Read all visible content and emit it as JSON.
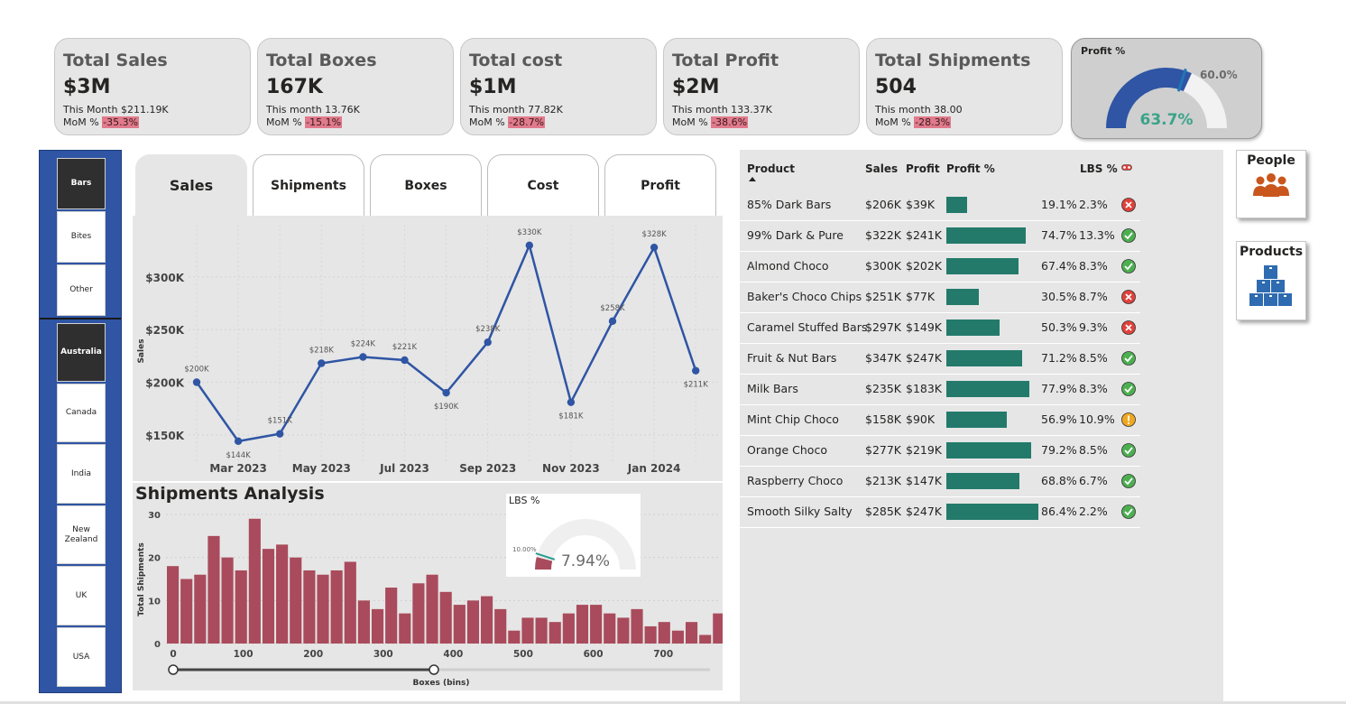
{
  "kpis": [
    {
      "title": "Total Sales",
      "value": "$3M",
      "month": "This Month $211.19K",
      "mom_label": "MoM % ",
      "mom": "-35.3%"
    },
    {
      "title": "Total Boxes",
      "value": "167K",
      "month": "This month 13.76K",
      "mom_label": "MoM % ",
      "mom": "-15.1%"
    },
    {
      "title": "Total cost",
      "value": "$1M",
      "month": "This month 77.82K",
      "mom_label": "MoM % ",
      "mom": "-28.7%"
    },
    {
      "title": "Total Profit",
      "value": "$2M",
      "month": "This month 133.37K",
      "mom_label": "MoM % ",
      "mom": "-38.6%"
    },
    {
      "title": "Total Shipments",
      "value": "504",
      "month": "This month 38.00",
      "mom_label": "MoM % ",
      "mom": "-28.3%"
    }
  ],
  "profit_gauge": {
    "title": "Profit %",
    "value": "63.7%",
    "target": "60.0%",
    "fill_fraction": 0.637,
    "target_fraction": 0.6
  },
  "slicer": {
    "categories": [
      "Bars",
      "Bites",
      "Other"
    ],
    "selected_category": "Bars",
    "countries": [
      "Australia",
      "Canada",
      "India",
      "New Zealand",
      "UK",
      "USA"
    ],
    "selected_country": "Australia"
  },
  "tabs": [
    "Sales",
    "Shipments",
    "Boxes",
    "Cost",
    "Profit"
  ],
  "active_tab": "Sales",
  "line_chart": {
    "ylabel": "Sales",
    "yticks": [
      "$300K",
      "$250K",
      "$200K",
      "$150K"
    ],
    "xticks": [
      "Mar 2023",
      "May 2023",
      "Jul 2023",
      "Sep 2023",
      "Nov 2023",
      "Jan 2024"
    ]
  },
  "shipments": {
    "title": "Shipments Analysis",
    "ylabel": "Total Shipments",
    "xlabel": "Boxes (bins)",
    "yticks": [
      "30",
      "20",
      "10",
      "0"
    ],
    "xticks": [
      "0",
      "100",
      "200",
      "300",
      "400",
      "500",
      "600",
      "700"
    ]
  },
  "lbs_gauge": {
    "title": "LBS %",
    "value": "7.94%",
    "target": "10.00%",
    "fill_fraction": 0.0794,
    "target_fraction": 0.1
  },
  "table": {
    "headers": {
      "product": "Product",
      "sales": "Sales",
      "profit": "Profit",
      "profit_pct": "Profit %",
      "lbs": "LBS %"
    },
    "rows": [
      {
        "product": "85% Dark Bars",
        "sales": "$206K",
        "profit": "$39K",
        "pct": "19.1%",
        "pct_value": 19.1,
        "lbs": "2.3%",
        "status": "bad"
      },
      {
        "product": "99% Dark & Pure",
        "sales": "$322K",
        "profit": "$241K",
        "pct": "74.7%",
        "pct_value": 74.7,
        "lbs": "13.3%",
        "status": "good"
      },
      {
        "product": "Almond Choco",
        "sales": "$300K",
        "profit": "$202K",
        "pct": "67.4%",
        "pct_value": 67.4,
        "lbs": "8.3%",
        "status": "good"
      },
      {
        "product": "Baker's Choco Chips",
        "sales": "$251K",
        "profit": "$77K",
        "pct": "30.5%",
        "pct_value": 30.5,
        "lbs": "8.7%",
        "status": "bad"
      },
      {
        "product": "Caramel Stuffed Bars",
        "sales": "$297K",
        "profit": "$149K",
        "pct": "50.3%",
        "pct_value": 50.3,
        "lbs": "9.3%",
        "status": "bad"
      },
      {
        "product": "Fruit & Nut Bars",
        "sales": "$347K",
        "profit": "$247K",
        "pct": "71.2%",
        "pct_value": 71.2,
        "lbs": "8.5%",
        "status": "good"
      },
      {
        "product": "Milk Bars",
        "sales": "$235K",
        "profit": "$183K",
        "pct": "77.9%",
        "pct_value": 77.9,
        "lbs": "8.3%",
        "status": "good"
      },
      {
        "product": "Mint Chip Choco",
        "sales": "$158K",
        "profit": "$90K",
        "pct": "56.9%",
        "pct_value": 56.9,
        "lbs": "10.9%",
        "status": "warn"
      },
      {
        "product": "Orange Choco",
        "sales": "$277K",
        "profit": "$219K",
        "pct": "79.2%",
        "pct_value": 79.2,
        "lbs": "8.5%",
        "status": "good"
      },
      {
        "product": "Raspberry Choco",
        "sales": "$213K",
        "profit": "$147K",
        "pct": "68.8%",
        "pct_value": 68.8,
        "lbs": "6.7%",
        "status": "good"
      },
      {
        "product": "Smooth Silky Salty",
        "sales": "$285K",
        "profit": "$247K",
        "pct": "86.4%",
        "pct_value": 86.4,
        "lbs": "2.2%",
        "status": "good"
      }
    ]
  },
  "nav": {
    "people": "People",
    "products": "Products"
  },
  "colors": {
    "line": "#2f55a4",
    "bar": "#a94b5c",
    "profit_bar": "#237a6b",
    "good": "#4caf50",
    "bad": "#e0413a",
    "warn": "#f0a820"
  },
  "chart_data": [
    {
      "type": "line",
      "ylabel": "Sales",
      "ylim": [
        125000,
        335000
      ],
      "x": [
        "Feb 2023",
        "Mar 2023",
        "Apr 2023",
        "May 2023",
        "Jun 2023",
        "Jul 2023",
        "Aug 2023",
        "Sep 2023",
        "Oct 2023",
        "Nov 2023",
        "Dec 2023",
        "Jan 2024",
        "Feb 2024"
      ],
      "values": [
        200000,
        144000,
        151000,
        218000,
        224000,
        221000,
        190000,
        238000,
        330000,
        181000,
        258000,
        328000,
        211000
      ],
      "labels": [
        "$200K",
        "$144K",
        "$151K",
        "$218K",
        "$224K",
        "$221K",
        "$190K",
        "$238K",
        "$330K",
        "$181K",
        "$258K",
        "$328K",
        "$211K"
      ]
    },
    {
      "type": "bar",
      "title": "Shipments Analysis",
      "xlabel": "Boxes (bins)",
      "ylabel": "Total Shipments",
      "ylim": [
        0,
        32
      ],
      "xlim": [
        0,
        790
      ],
      "bin_width": 19.5,
      "values": [
        18,
        15,
        16,
        25,
        20,
        17,
        29,
        22,
        23,
        20,
        17,
        16,
        17,
        19,
        10,
        8,
        13,
        7,
        14,
        16,
        12,
        9,
        10,
        11,
        8,
        3,
        6,
        6,
        5,
        7,
        9,
        9,
        7,
        6,
        8,
        4,
        5,
        3,
        5,
        2,
        7
      ]
    }
  ]
}
